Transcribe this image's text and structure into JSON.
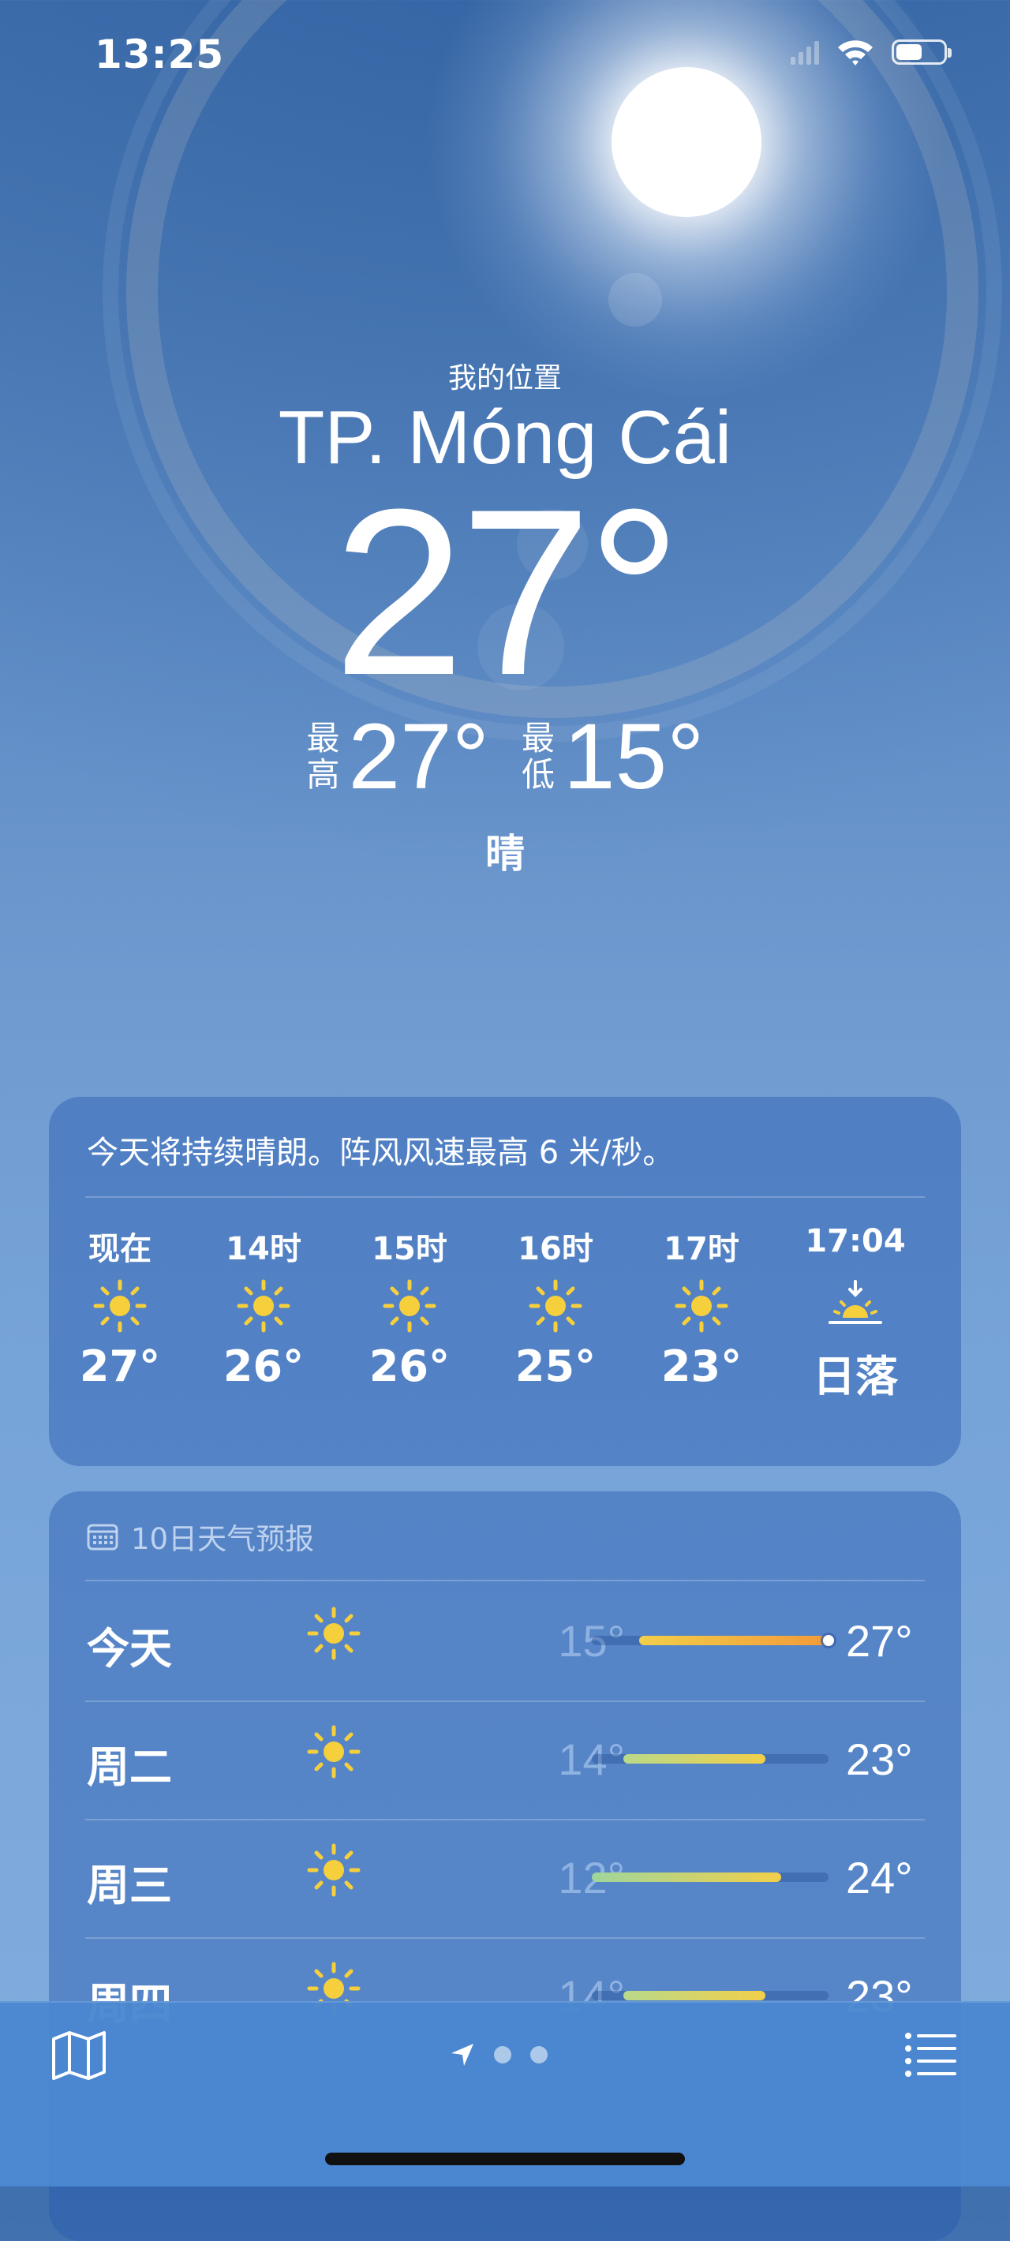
{
  "status_bar": {
    "time": "13:25",
    "battery_level": 0.55
  },
  "header": {
    "my_location": "我的位置",
    "city": "TP. Móng Cái",
    "temperature": "27°",
    "high_label": "最高",
    "high": "27°",
    "low_label": "最低",
    "low": "15°",
    "condition": "晴"
  },
  "hourly": {
    "summary": "今天将持续晴朗。阵风风速最高 6 米/秒。",
    "items": [
      {
        "time": "现在",
        "icon": "sun-icon",
        "temp": "27°"
      },
      {
        "time": "14时",
        "icon": "sun-icon",
        "temp": "26°"
      },
      {
        "time": "15时",
        "icon": "sun-icon",
        "temp": "26°"
      },
      {
        "time": "16时",
        "icon": "sun-icon",
        "temp": "25°"
      },
      {
        "time": "17时",
        "icon": "sun-icon",
        "temp": "23°"
      },
      {
        "time": "17:04",
        "icon": "sunset-icon",
        "temp": "日落"
      }
    ]
  },
  "forecast": {
    "title": "10日天气预报",
    "range": [
      12,
      27
    ],
    "days": [
      {
        "day": "今天",
        "icon": "sun-icon",
        "low": "15°",
        "high": "27°",
        "low_value": 15,
        "high_value": 27,
        "current_value": 27,
        "colors": [
          "#f2cf49",
          "#f29a3a"
        ]
      },
      {
        "day": "周二",
        "icon": "sun-icon",
        "low": "14°",
        "high": "23°",
        "low_value": 14,
        "high_value": 23,
        "colors": [
          "#b9d98a",
          "#f2cf49"
        ]
      },
      {
        "day": "周三",
        "icon": "sun-icon",
        "low": "12°",
        "high": "24°",
        "low_value": 12,
        "high_value": 24,
        "colors": [
          "#9fd69c",
          "#f2cf49"
        ]
      },
      {
        "day": "周四",
        "icon": "sun-icon",
        "low": "14°",
        "high": "23°",
        "low_value": 14,
        "high_value": 23,
        "colors": [
          "#b9d98a",
          "#f2cf49"
        ]
      }
    ]
  },
  "colors": {
    "sun": "#f6cf3d",
    "background": "#5a88c2"
  }
}
